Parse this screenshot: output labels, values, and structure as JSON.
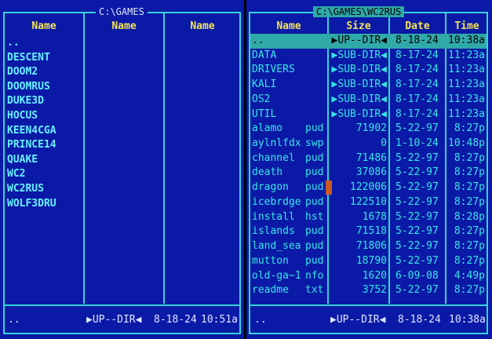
{
  "left_panel": {
    "path": "C:\\GAMES",
    "headers": [
      "Name",
      "Name",
      "Name"
    ],
    "items": [
      "..",
      "DESCENT",
      "DOOM2",
      "DOOMRUS",
      "DUKE3D",
      "HOCUS",
      "KEEN4CGA",
      "PRINCE14",
      "QUAKE",
      "WC2",
      "WC2RUS",
      "WOLF3DRU"
    ],
    "status": {
      "name": "..",
      "size": "▶UP--DIR◀",
      "date": "8-18-24",
      "time": "10:51a"
    }
  },
  "right_panel": {
    "path": "C:\\GAMES\\WC2RUS",
    "headers": {
      "name": "Name",
      "size": "Size",
      "date": "Date",
      "time": "Time"
    },
    "rows": [
      {
        "name": "..",
        "ext": "",
        "size": "▶UP--DIR◀",
        "date": "8-18-24",
        "time": "10:38a",
        "cursor": true
      },
      {
        "name": "DATA",
        "ext": "",
        "size": "▶SUB-DIR◀",
        "date": "8-17-24",
        "time": "11:23a"
      },
      {
        "name": "DRIVERS",
        "ext": "",
        "size": "▶SUB-DIR◀",
        "date": "8-17-24",
        "time": "11:23a"
      },
      {
        "name": "KALI",
        "ext": "",
        "size": "▶SUB-DIR◀",
        "date": "8-17-24",
        "time": "11:23a"
      },
      {
        "name": "OS2",
        "ext": "",
        "size": "▶SUB-DIR◀",
        "date": "8-17-24",
        "time": "11:23a"
      },
      {
        "name": "UTIL",
        "ext": "",
        "size": "▶SUB-DIR◀",
        "date": "8-17-24",
        "time": "11:23a"
      },
      {
        "name": "alamo",
        "ext": "pud",
        "size": "71902",
        "date": "5-22-97",
        "time": "8:27p"
      },
      {
        "name": "aylnlfdx",
        "ext": "swp",
        "size": "0",
        "date": "1-10-24",
        "time": "10:48p"
      },
      {
        "name": "channel",
        "ext": "pud",
        "size": "71486",
        "date": "5-22-97",
        "time": "8:27p"
      },
      {
        "name": "death",
        "ext": "pud",
        "size": "37086",
        "date": "5-22-97",
        "time": "8:27p"
      },
      {
        "name": "dragon",
        "ext": "pud",
        "size": "122006",
        "date": "5-22-97",
        "time": "8:27p",
        "marked": true
      },
      {
        "name": "icebrdge",
        "ext": "pud",
        "size": "122510",
        "date": "5-22-97",
        "time": "8:27p"
      },
      {
        "name": "install",
        "ext": "hst",
        "size": "1678",
        "date": "5-22-97",
        "time": "8:28p"
      },
      {
        "name": "islands",
        "ext": "pud",
        "size": "71518",
        "date": "5-22-97",
        "time": "8:27p"
      },
      {
        "name": "land_sea",
        "ext": "pud",
        "size": "71806",
        "date": "5-22-97",
        "time": "8:27p"
      },
      {
        "name": "mutton",
        "ext": "pud",
        "size": "18790",
        "date": "5-22-97",
        "time": "8:27p"
      },
      {
        "name": "old-ga~1",
        "ext": "nfo",
        "size": "1620",
        "date": "6-09-08",
        "time": "4:49p"
      },
      {
        "name": "readme",
        "ext": "txt",
        "size": "3752",
        "date": "5-22-97",
        "time": "8:27p"
      }
    ],
    "status": {
      "name": "..",
      "size": "▶UP--DIR◀",
      "date": "8-18-24",
      "time": "10:38a"
    }
  },
  "colors": {
    "panel_bg": "#0b1aa6",
    "border": "#36d3d8",
    "header_text": "#f4e25a",
    "file_text": "#36e6e6",
    "cursor_bg": "#30aaa8",
    "marker": "#cc5a20"
  }
}
